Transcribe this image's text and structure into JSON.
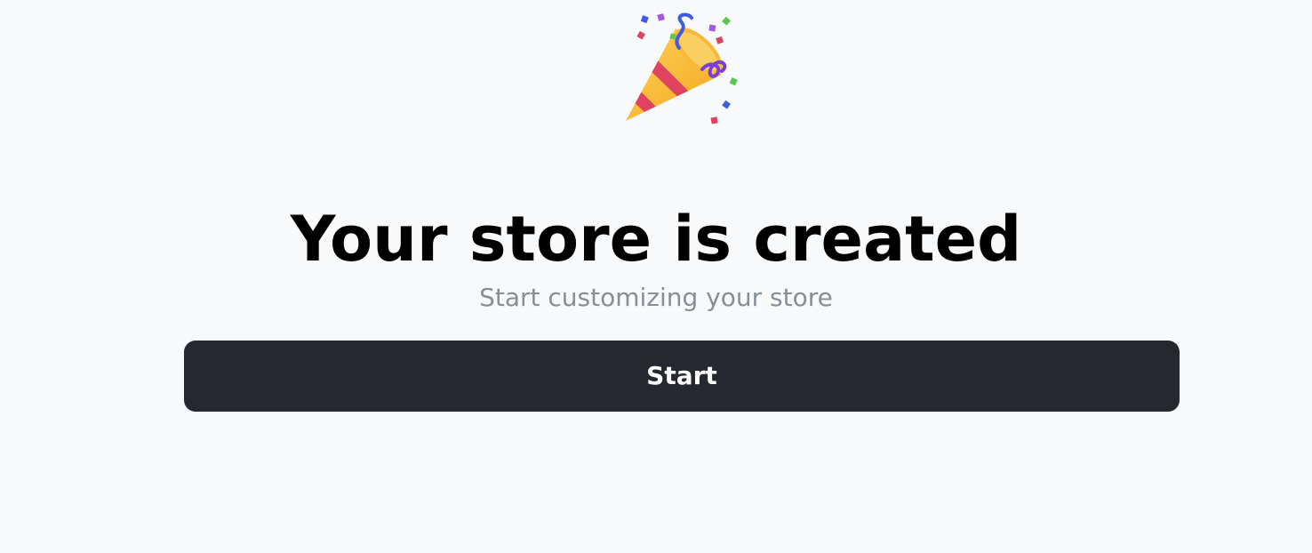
{
  "hero": {
    "icon": "party-popper-icon",
    "title": "Your store is created",
    "subtitle": "Start customizing your store"
  },
  "actions": {
    "start_label": "Start"
  },
  "colors": {
    "background": "#f8f9fa",
    "title": "#000000",
    "subtitle": "#868e96",
    "button_bg": "#25282f",
    "button_text": "#ffffff"
  }
}
